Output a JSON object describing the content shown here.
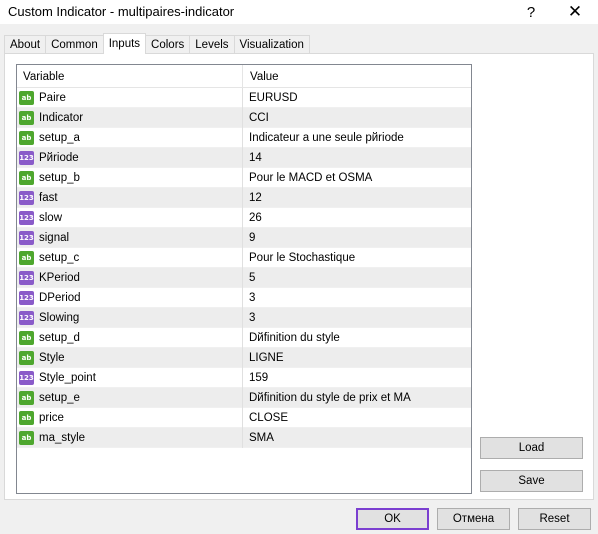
{
  "window": {
    "title": "Custom Indicator - multipaires-indicator",
    "help_glyph": "?",
    "close_glyph": "✕"
  },
  "tabs": [
    {
      "label": "About"
    },
    {
      "label": "Common"
    },
    {
      "label": "Inputs",
      "active": true
    },
    {
      "label": "Colors"
    },
    {
      "label": "Levels"
    },
    {
      "label": "Visualization"
    }
  ],
  "grid": {
    "headers": {
      "variable": "Variable",
      "value": "Value"
    },
    "rows": [
      {
        "type": "string",
        "icon_text": "ab",
        "variable": "Paire",
        "value": "EURUSD"
      },
      {
        "type": "string",
        "icon_text": "ab",
        "variable": "Indicator",
        "value": "CCI"
      },
      {
        "type": "string",
        "icon_text": "ab",
        "variable": "setup_a",
        "value": " Indicateur a une seule pйriode"
      },
      {
        "type": "int",
        "icon_text": "123",
        "variable": "Pйriode",
        "value": "14"
      },
      {
        "type": "string",
        "icon_text": "ab",
        "variable": "setup_b",
        "value": "Pour le MACD et OSMA"
      },
      {
        "type": "int",
        "icon_text": "123",
        "variable": "fast",
        "value": "12"
      },
      {
        "type": "int",
        "icon_text": "123",
        "variable": "slow",
        "value": "26"
      },
      {
        "type": "int",
        "icon_text": "123",
        "variable": "signal",
        "value": "9"
      },
      {
        "type": "string",
        "icon_text": "ab",
        "variable": "setup_c",
        "value": "Pour le Stochastique"
      },
      {
        "type": "int",
        "icon_text": "123",
        "variable": "KPeriod",
        "value": "5"
      },
      {
        "type": "int",
        "icon_text": "123",
        "variable": "DPeriod",
        "value": "3"
      },
      {
        "type": "int",
        "icon_text": "123",
        "variable": "Slowing",
        "value": "3"
      },
      {
        "type": "string",
        "icon_text": "ab",
        "variable": "setup_d",
        "value": "Dйfinition du style"
      },
      {
        "type": "string",
        "icon_text": "ab",
        "variable": "Style",
        "value": "LIGNE"
      },
      {
        "type": "int",
        "icon_text": "123",
        "variable": "Style_point",
        "value": "159"
      },
      {
        "type": "string",
        "icon_text": "ab",
        "variable": "setup_e",
        "value": "Dйfinition du style de prix et MA"
      },
      {
        "type": "string",
        "icon_text": "ab",
        "variable": "price",
        "value": "CLOSE"
      },
      {
        "type": "string",
        "icon_text": "ab",
        "variable": "ma_style",
        "value": "SMA"
      }
    ]
  },
  "buttons": {
    "load": "Load",
    "save": "Save",
    "ok": "OK",
    "cancel": "Отмена",
    "reset": "Reset"
  },
  "colors": {
    "string_icon": "#4ea72e",
    "int_icon": "#8a5bc9",
    "ok_border": "#7b3fd0"
  }
}
